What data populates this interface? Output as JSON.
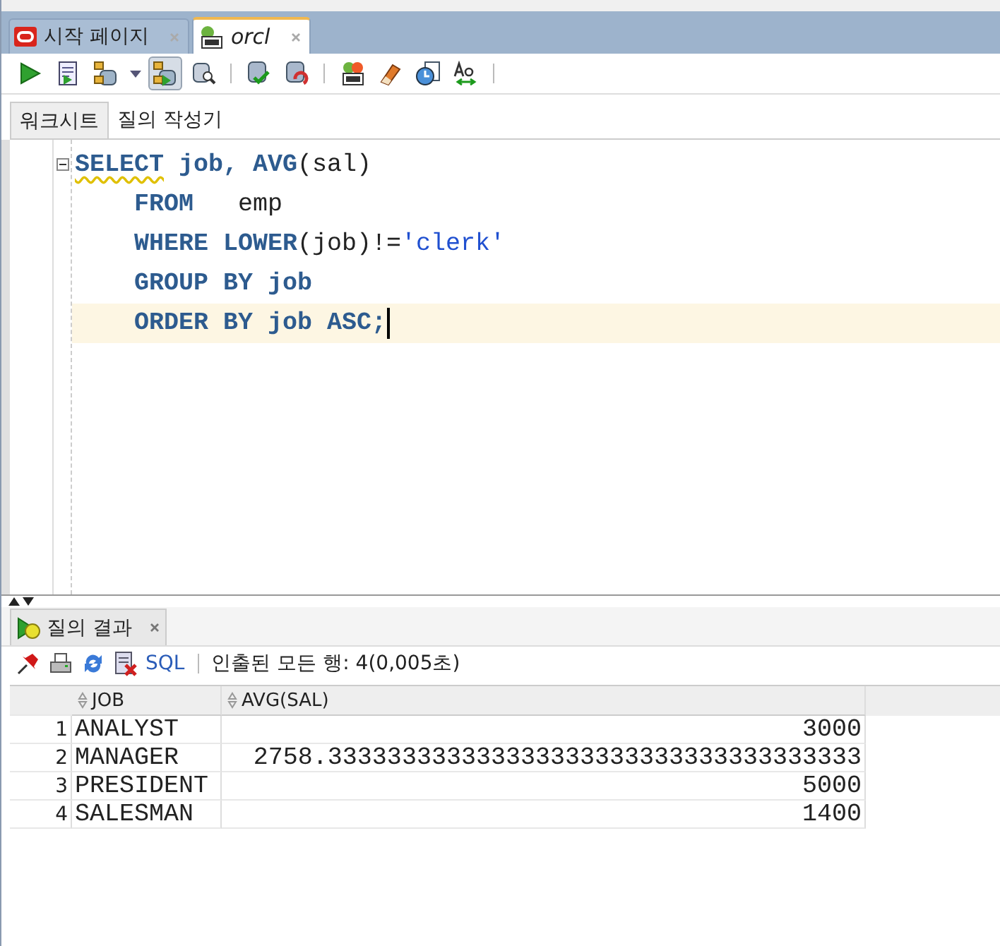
{
  "document_tabs": [
    {
      "label": "시작 페이지",
      "selected": false,
      "kind": "start"
    },
    {
      "label": "orcl",
      "selected": true,
      "kind": "worksheet"
    }
  ],
  "toolbar": [
    {
      "kind": "run",
      "pressed": false
    },
    {
      "kind": "script",
      "pressed": false
    },
    {
      "kind": "db",
      "pressed": false
    },
    {
      "kind": "dropdown"
    },
    {
      "kind": "autotrace",
      "pressed": true
    },
    {
      "kind": "explain",
      "pressed": false
    },
    {
      "kind": "sep"
    },
    {
      "kind": "commit",
      "pressed": false
    },
    {
      "kind": "rollback",
      "pressed": false
    },
    {
      "kind": "sep"
    },
    {
      "kind": "tuning",
      "pressed": false
    },
    {
      "kind": "eraser",
      "pressed": false
    },
    {
      "kind": "history",
      "pressed": false
    },
    {
      "kind": "case",
      "pressed": false
    },
    {
      "kind": "sep"
    }
  ],
  "editor_tabs": [
    {
      "label": "워크시트",
      "selected": true
    },
    {
      "label": "질의 작성기",
      "selected": false
    }
  ],
  "editor": {
    "lines": [
      {
        "fold": true,
        "current": false,
        "tokens": [
          {
            "kind": "keyword",
            "text": "SELECT",
            "warn": true
          },
          {
            "kind": "keyword",
            "text": " job, AVG"
          },
          {
            "kind": "plain",
            "text": "(sal)"
          }
        ]
      },
      {
        "fold": false,
        "current": false,
        "tokens": [
          {
            "kind": "keyword",
            "text": "    FROM"
          },
          {
            "kind": "plain",
            "text": "   emp"
          }
        ]
      },
      {
        "fold": false,
        "current": false,
        "tokens": [
          {
            "kind": "keyword",
            "text": "    WHERE LOWER"
          },
          {
            "kind": "plain",
            "text": "(job)!="
          },
          {
            "kind": "string",
            "text": "'clerk'"
          }
        ]
      },
      {
        "fold": false,
        "current": false,
        "tokens": [
          {
            "kind": "keyword",
            "text": "    GROUP BY job"
          }
        ]
      },
      {
        "fold": false,
        "current": true,
        "tokens": [
          {
            "kind": "keyword",
            "text": "    ORDER BY job ASC;"
          }
        ]
      }
    ]
  },
  "results": {
    "tab": {
      "label": "질의 결과"
    },
    "toolbar": [
      {
        "kind": "pin"
      },
      {
        "kind": "print"
      },
      {
        "kind": "refresh"
      },
      {
        "kind": "clear"
      }
    ],
    "sql_link": "SQL",
    "status": "인출된 모든 행: 4(0,005초)",
    "columns": [
      "JOB",
      "AVG(SAL)"
    ],
    "rows": [
      {
        "num": "1",
        "job": "ANALYST",
        "avg": "3000"
      },
      {
        "num": "2",
        "job": "MANAGER",
        "avg": "2758.333333333333333333333333333333333333"
      },
      {
        "num": "3",
        "job": "PRESIDENT",
        "avg": "5000"
      },
      {
        "num": "4",
        "job": "SALESMAN",
        "avg": "1400"
      }
    ]
  }
}
